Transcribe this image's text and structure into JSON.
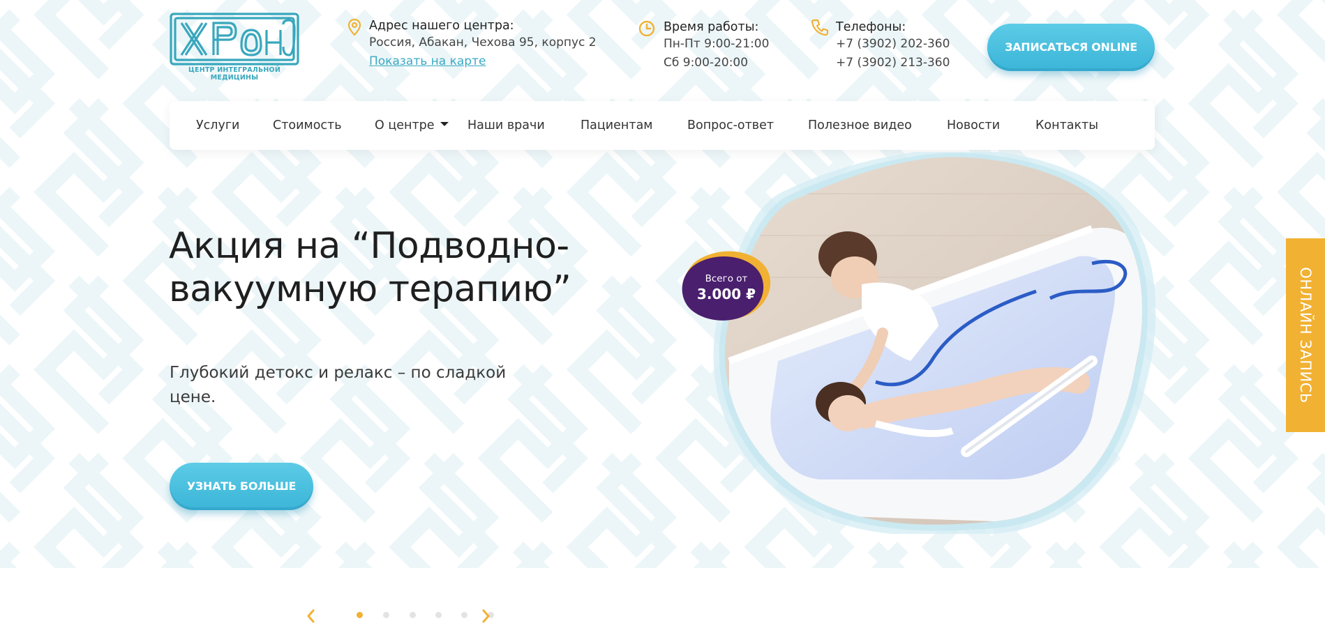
{
  "header": {
    "logo": {
      "wordmark": "ХРОНО",
      "subtitle": "ЦЕНТР ИНТЕГРАЛЬНОЙ МЕДИЦИНЫ"
    },
    "address": {
      "icon": "map-pin-icon",
      "title": "Адрес нашего центра:",
      "value": "Россия, Абакан, Чехова 95, корпус 2",
      "map_link": "Показать на карте"
    },
    "hours": {
      "icon": "clock-icon",
      "title": "Время работы:",
      "weekdays": "Пн-Пт 9:00-21:00",
      "saturday": "Сб 9:00-20:00"
    },
    "phones": {
      "icon": "phone-icon",
      "title": "Телефоны:",
      "phone1": "+7 (3902) 202-360",
      "phone2": "+7 (3902) 213-360"
    },
    "cta_label": "ЗАПИСАТЬСЯ ONLINE"
  },
  "nav": {
    "items": [
      {
        "label": "Услуги"
      },
      {
        "label": "Стоимость"
      },
      {
        "label": "О центре",
        "has_dropdown": true
      },
      {
        "label": "Наши врачи"
      },
      {
        "label": "Пациентам"
      },
      {
        "label": "Вопрос-ответ"
      },
      {
        "label": "Полезное видео"
      },
      {
        "label": "Новости"
      },
      {
        "label": "Контакты"
      }
    ]
  },
  "hero": {
    "title": "Акция на “Подводно-вакуумную терапию”",
    "subtitle": "Глубокий детокс и релакс – по сладкой цене.",
    "button_label": "УЗНАТЬ БОЛЬШЕ",
    "badge": {
      "label": "Всего от",
      "price": "3.000 ₽"
    }
  },
  "side_tab": {
    "label": "ОНЛАЙН ЗАПИСЬ"
  },
  "slider": {
    "prev_icon": "chevron-left-icon",
    "next_icon": "chevron-right-icon",
    "dots_count": 6,
    "active_index": 0
  },
  "colors": {
    "accent": "#3bb5d8",
    "accent_light": "#5ccbe6",
    "gold": "#f1b133",
    "purple": "#4a1f6e",
    "logo": "#38a7bd"
  }
}
